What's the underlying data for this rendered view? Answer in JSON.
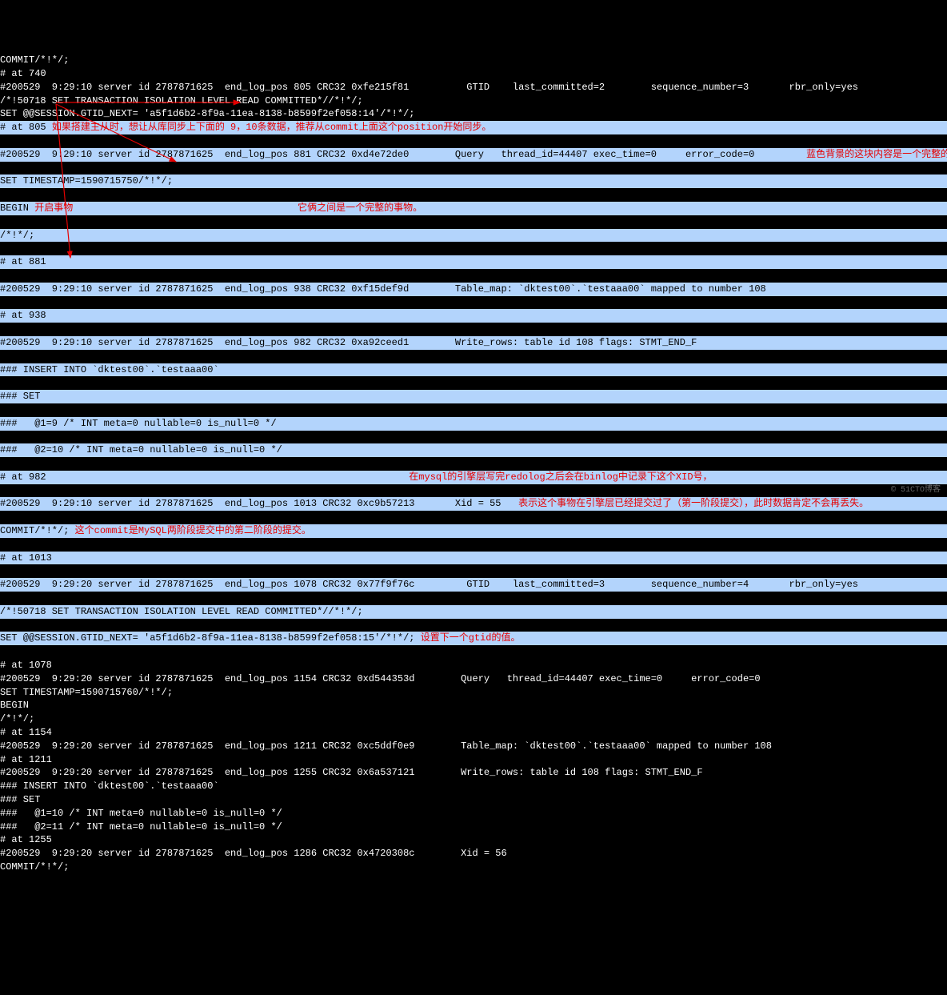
{
  "lines": [
    {
      "t": "COMMIT/*!*/;"
    },
    {
      "t": "# at 740"
    },
    {
      "t": "#200529  9:29:10 server id 2787871625  end_log_pos 805 CRC32 0xfe215f81          GTID    last_committed=2        sequence_number=3       rbr_only=yes"
    },
    {
      "t": "/*!50718 SET TRANSACTION ISOLATION LEVEL READ COMMITTED*//*!*/;"
    },
    {
      "t": "SET @@SESSION.GTID_NEXT= 'a5f1d6b2-8f9a-11ea-8138-b8599f2ef058:14'/*!*/;"
    },
    {
      "hl": true,
      "parts": [
        {
          "t": "# at 805 "
        },
        {
          "t": "如果搭建主从时，想让从库同步上下面的 9，10条数据，推荐从commit上面这个position开始同步。",
          "r": true
        }
      ]
    },
    {
      "hl": true,
      "parts": [
        {
          "t": "#200529  9:29:10 server id 2787871625  end_log_pos 881 CRC32 0xd4e72de0        Query   thread_id=44407 exec_time=0     error_code=0         "
        },
        {
          "t": "蓝色背景的这块内容是一个完整的binlog。",
          "r": true
        }
      ]
    },
    {
      "hl": true,
      "t": "SET TIMESTAMP=1590715750/*!*/;"
    },
    {
      "hl": true,
      "parts": [
        {
          "t": "BEGIN "
        },
        {
          "t": "开启事物",
          "r": true
        },
        {
          "t": "                                       "
        },
        {
          "t": "它俩之间是一个完整的事物。",
          "r": true
        }
      ]
    },
    {
      "hl": true,
      "t": "/*!*/;"
    },
    {
      "hl": true,
      "t": "# at 881"
    },
    {
      "hl": true,
      "t": "#200529  9:29:10 server id 2787871625  end_log_pos 938 CRC32 0xf15def9d        Table_map: `dktest00`.`testaaa00` mapped to number 108"
    },
    {
      "hl": true,
      "t": "# at 938"
    },
    {
      "hl": true,
      "t": "#200529  9:29:10 server id 2787871625  end_log_pos 982 CRC32 0xa92ceed1        Write_rows: table id 108 flags: STMT_END_F"
    },
    {
      "hl": true,
      "t": "### INSERT INTO `dktest00`.`testaaa00`"
    },
    {
      "hl": true,
      "t": "### SET"
    },
    {
      "hl": true,
      "t": "###   @1=9 /* INT meta=0 nullable=0 is_null=0 */"
    },
    {
      "hl": true,
      "t": "###   @2=10 /* INT meta=0 nullable=0 is_null=0 */"
    },
    {
      "hl": true,
      "parts": [
        {
          "t": "# at 982"
        },
        {
          "t": "                                                               "
        },
        {
          "t": "在mysql的引擎层写完redolog之后会在binlog中记录下这个XID号，",
          "r": true
        }
      ]
    },
    {
      "hl": true,
      "parts": [
        {
          "t": "#200529  9:29:10 server id 2787871625  end_log_pos 1013 CRC32 0xc9b57213       Xid = 55   "
        },
        {
          "t": "表示这个事物在引擎层已经提交过了（第一阶段提交），此时数据肯定不会再丢失。",
          "r": true
        }
      ]
    },
    {
      "hl": true,
      "parts": [
        {
          "t": "COMMIT/*!*/; "
        },
        {
          "t": "这个commit是MySQL两阶段提交中的第二阶段的提交。",
          "r": true
        }
      ]
    },
    {
      "hl": true,
      "t": "# at 1013"
    },
    {
      "hl": true,
      "t": "#200529  9:29:20 server id 2787871625  end_log_pos 1078 CRC32 0x77f9f76c         GTID    last_committed=3        sequence_number=4       rbr_only=yes"
    },
    {
      "hl": true,
      "t": "/*!50718 SET TRANSACTION ISOLATION LEVEL READ COMMITTED*//*!*/;"
    },
    {
      "hl": true,
      "parts": [
        {
          "t": "SET @@SESSION.GTID_NEXT= 'a5f1d6b2-8f9a-11ea-8138-b8599f2ef058:15'/*!*/; "
        },
        {
          "t": "设置下一个gtid的值。",
          "r": true
        }
      ]
    },
    {
      "t": "# at 1078"
    },
    {
      "t": "#200529  9:29:20 server id 2787871625  end_log_pos 1154 CRC32 0xd544353d        Query   thread_id=44407 exec_time=0     error_code=0"
    },
    {
      "t": "SET TIMESTAMP=1590715760/*!*/;"
    },
    {
      "t": "BEGIN"
    },
    {
      "t": "/*!*/;"
    },
    {
      "t": "# at 1154"
    },
    {
      "t": "#200529  9:29:20 server id 2787871625  end_log_pos 1211 CRC32 0xc5ddf0e9        Table_map: `dktest00`.`testaaa00` mapped to number 108"
    },
    {
      "t": "# at 1211"
    },
    {
      "t": "#200529  9:29:20 server id 2787871625  end_log_pos 1255 CRC32 0x6a537121        Write_rows: table id 108 flags: STMT_END_F"
    },
    {
      "t": "### INSERT INTO `dktest00`.`testaaa00`"
    },
    {
      "t": "### SET"
    },
    {
      "t": "###   @1=10 /* INT meta=0 nullable=0 is_null=0 */"
    },
    {
      "t": "###   @2=11 /* INT meta=0 nullable=0 is_null=0 */"
    },
    {
      "t": "# at 1255"
    },
    {
      "t": "#200529  9:29:20 server id 2787871625  end_log_pos 1286 CRC32 0x4720308c        Xid = 56"
    },
    {
      "t": "COMMIT/*!*/;"
    }
  ],
  "watermark": "© 51CTO博客"
}
